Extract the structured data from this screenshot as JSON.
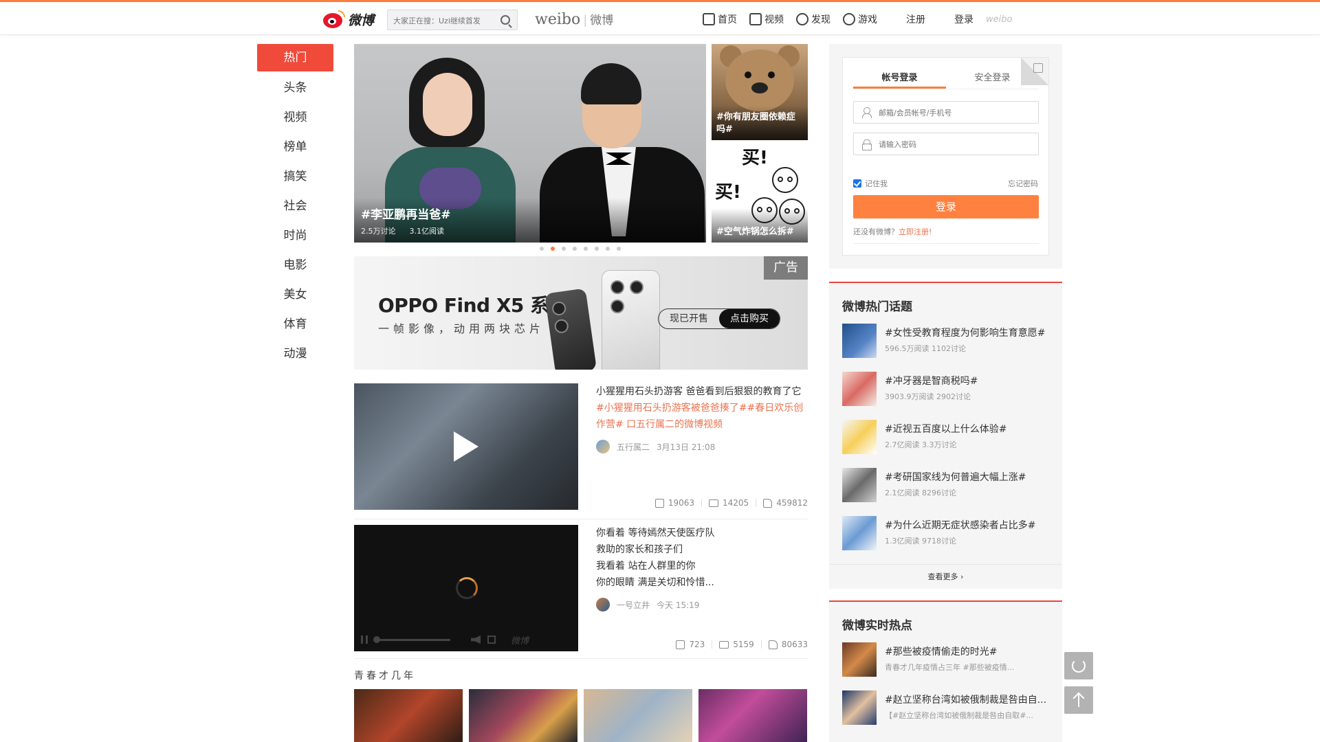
{
  "header": {
    "logo_text": "微博",
    "search_placeholder": "大家正在搜：Uzi继续首发",
    "brand_en": "weibo",
    "brand_cn": "微博",
    "nav": [
      {
        "label": "首页",
        "icon": "home-icon"
      },
      {
        "label": "视频",
        "icon": "video-icon"
      },
      {
        "label": "发现",
        "icon": "discover-icon"
      },
      {
        "label": "游戏",
        "icon": "game-icon"
      }
    ],
    "register_label": "注册",
    "login_label": "登录",
    "weibo_small": "weibo"
  },
  "sidebar": {
    "items": [
      "热门",
      "头条",
      "视频",
      "榜单",
      "搞笑",
      "社会",
      "时尚",
      "电影",
      "美女",
      "体育",
      "动漫"
    ],
    "active_index": 0
  },
  "carousel": {
    "main": {
      "title": "#李亚鹏再当爸#",
      "discussions": "2.5万讨论",
      "reads": "3.1亿阅读"
    },
    "side": [
      {
        "caption": "#你有朋友圈依赖症吗#"
      },
      {
        "caption": "#空气炸锅怎么拆#"
      }
    ],
    "cartoon_text": [
      "买!",
      "买!"
    ],
    "dots": 8,
    "active_dot": 1
  },
  "ad": {
    "title": "OPPO Find X5 系列",
    "subtitle": "一帧影像，动用两块芯片",
    "btn_on_sale": "现已开售",
    "btn_buy": "点击购买",
    "tag": "广告"
  },
  "feed": [
    {
      "text_plain": "小猩猩用石头扔游客 爸爸看到后狠狠的教育了它",
      "text_tag": "#小猩猩用石头扔游客被爸爸揍了##春日欢乐创作营# 口五行属二的微博视频",
      "author": "五行属二",
      "time": "3月13日 21:08",
      "shares": "19063",
      "comments": "14205",
      "likes": "459812"
    },
    {
      "lines": [
        "你看着 等待嫣然天使医疗队",
        "救助的家长和孩子们",
        "我看着 站在人群里的你",
        "你的眼睛 满是关切和怜惜..."
      ],
      "author": "一号立井",
      "time": "今天 15:19",
      "shares": "723",
      "comments": "5159",
      "likes": "80633",
      "watermark": "微博"
    }
  ],
  "section": {
    "title": "青春才几年"
  },
  "login": {
    "tab_account": "帐号登录",
    "tab_secure": "安全登录",
    "username_placeholder": "邮箱/会员帐号/手机号",
    "password_placeholder": "请输入密码",
    "remember": "记住我",
    "forgot": "忘记密码",
    "submit": "登录",
    "no_account": "还没有微博？",
    "register_now": "立即注册!"
  },
  "hot_topics": {
    "title": "微博热门话题",
    "items": [
      {
        "title": "#女性受教育程度为何影响生育意愿#",
        "sub": "596.5万阅读 1102讨论"
      },
      {
        "title": "#冲牙器是智商税吗#",
        "sub": "3903.9万阅读 2902讨论"
      },
      {
        "title": "#近视五百度以上什么体验#",
        "sub": "2.7亿阅读 3.3万讨论"
      },
      {
        "title": "#考研国家线为何普遍大幅上涨#",
        "sub": "2.1亿阅读 8296讨论"
      },
      {
        "title": "#为什么近期无症状感染者占比多#",
        "sub": "1.3亿阅读 9718讨论"
      }
    ],
    "see_more": "查看更多 ›"
  },
  "realtime": {
    "title": "微博实时热点",
    "items": [
      {
        "title": "#那些被疫情偷走的时光#",
        "sub": "青春才几年疫情占三年 #那些被疫情..."
      },
      {
        "title": "#赵立坚称台湾如被俄制裁是咎由自...",
        "sub": "【#赵立坚称台湾如被俄制裁是咎由自取#..."
      }
    ]
  },
  "icons": {
    "refresh": "refresh-icon",
    "back_to_top": "arrow-up-icon"
  },
  "colors": {
    "accent": "#fa7d3c",
    "active_nav": "#f04a3b",
    "link": "#eb7350"
  }
}
